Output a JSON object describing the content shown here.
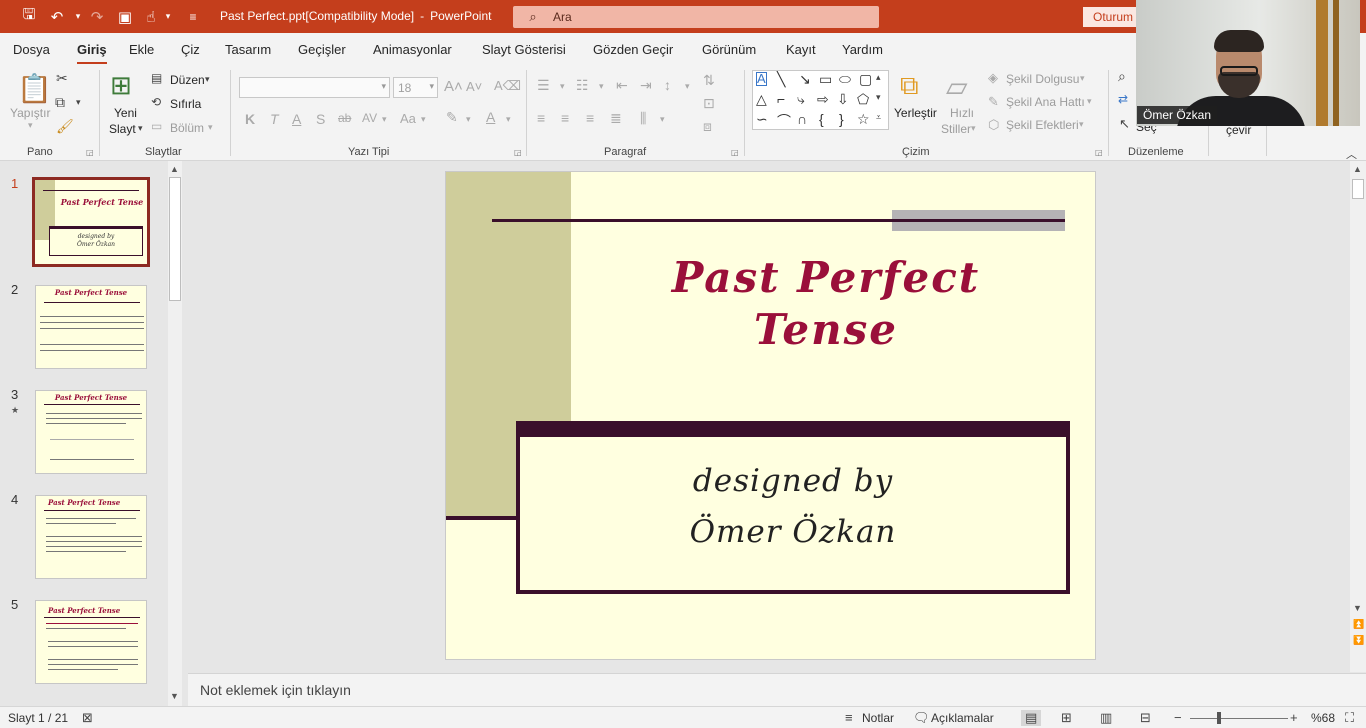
{
  "titlebar": {
    "doc_name": "Past Perfect.ppt[Compatibility Mode]",
    "separator": "-",
    "app_name": "PowerPoint",
    "search_placeholder": "Ara",
    "signin_label": "Oturum"
  },
  "menu": {
    "tabs": [
      "Dosya",
      "Giriş",
      "Ekle",
      "Çiz",
      "Tasarım",
      "Geçişler",
      "Animasyonlar",
      "Slayt Gösterisi",
      "Gözden Geçir",
      "Görünüm",
      "Kayıt",
      "Yardım"
    ],
    "active": "Giriş"
  },
  "ribbon": {
    "pano": {
      "label": "Pano",
      "paste": "Yapıştır"
    },
    "slaytlar": {
      "label": "Slaytlar",
      "new_slide_1": "Yeni",
      "new_slide_2": "Slayt",
      "layout": "Düzen",
      "reset": "Sıfırla",
      "section": "Bölüm"
    },
    "yazi_tipi": {
      "label": "Yazı Tipi",
      "font_size": "18",
      "bold": "K",
      "italic": "T",
      "underline": "A",
      "shadow": "S",
      "strike": "ab",
      "spacing": "AV",
      "case": "Aa"
    },
    "paragraf": {
      "label": "Paragraf"
    },
    "cizim": {
      "label": "Çizim",
      "arrange": "Yerleştir",
      "quick_styles_1": "Hızlı",
      "quick_styles_2": "Stiller",
      "fill": "Şekil Dolgusu",
      "outline": "Şekil Ana Hattı",
      "effects": "Şekil Efektleri"
    },
    "duzenleme": {
      "label": "Düzenleme",
      "select": "Seç",
      "replace": "çevir"
    }
  },
  "webcam": {
    "name": "Ömer Özkan"
  },
  "thumbnails": [
    {
      "num": "1",
      "title": "Past Perfect Tense"
    },
    {
      "num": "2",
      "title": "Past Perfect Tense"
    },
    {
      "num": "3",
      "title": "Past Perfect Tense"
    },
    {
      "num": "4",
      "title": "Past Perfect Tense"
    },
    {
      "num": "5",
      "title": "Past Perfect Tense"
    }
  ],
  "slide": {
    "title_line1": "Past Perfect",
    "title_line2": "Tense",
    "subtitle_line1": "designed by",
    "subtitle_line2": "Ömer Özkan"
  },
  "notes": {
    "placeholder": "Not eklemek için tıklayın"
  },
  "status": {
    "slide_counter": "Slayt 1 / 21",
    "notes_label": "Notlar",
    "comments_label": "Açıklamalar",
    "zoom": "%68",
    "zoom_level": 0.68
  },
  "colors": {
    "accent": "#c43e1c",
    "slide_bg": "#ffffe0",
    "slide_title": "#9a0f3a",
    "slide_dark": "#3a0f2b",
    "slide_olive": "#cfcd9b"
  }
}
